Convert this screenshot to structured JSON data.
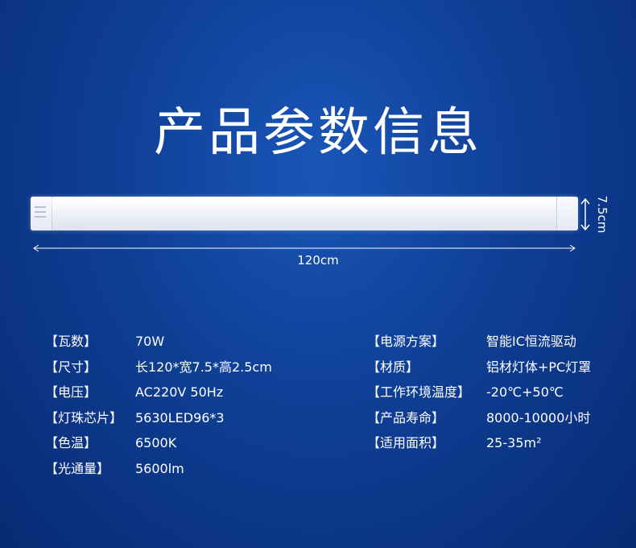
{
  "page": {
    "title": "产品参数信息",
    "background_color": "#0e3f95",
    "accent_color": "#ffffff"
  },
  "dimensions": {
    "width_label": "120cm",
    "height_label": "7.5cm"
  },
  "specs_left": [
    {
      "label": "【瓦数】",
      "value": "70W"
    },
    {
      "label": "【尺寸】",
      "value": "长120*宽7.5*高2.5cm"
    },
    {
      "label": "【电压】",
      "value": "AC220V 50Hz"
    },
    {
      "label": "【灯珠芯片】",
      "value": "5630LED96*3"
    },
    {
      "label": "【色温】",
      "value": "6500K"
    },
    {
      "label": "【光通量】",
      "value": "5600lm"
    }
  ],
  "specs_right": [
    {
      "label": "【电源方案】",
      "value": "智能IC恒流驱动"
    },
    {
      "label": "【材质】",
      "value": "铝材灯体+PC灯罩"
    },
    {
      "label": "【工作环境温度】",
      "value": "-20℃+50℃"
    },
    {
      "label": "【产品寿命】",
      "value": "8000-10000小时"
    },
    {
      "label": "【适用面积】",
      "value": "25-35m²"
    }
  ]
}
